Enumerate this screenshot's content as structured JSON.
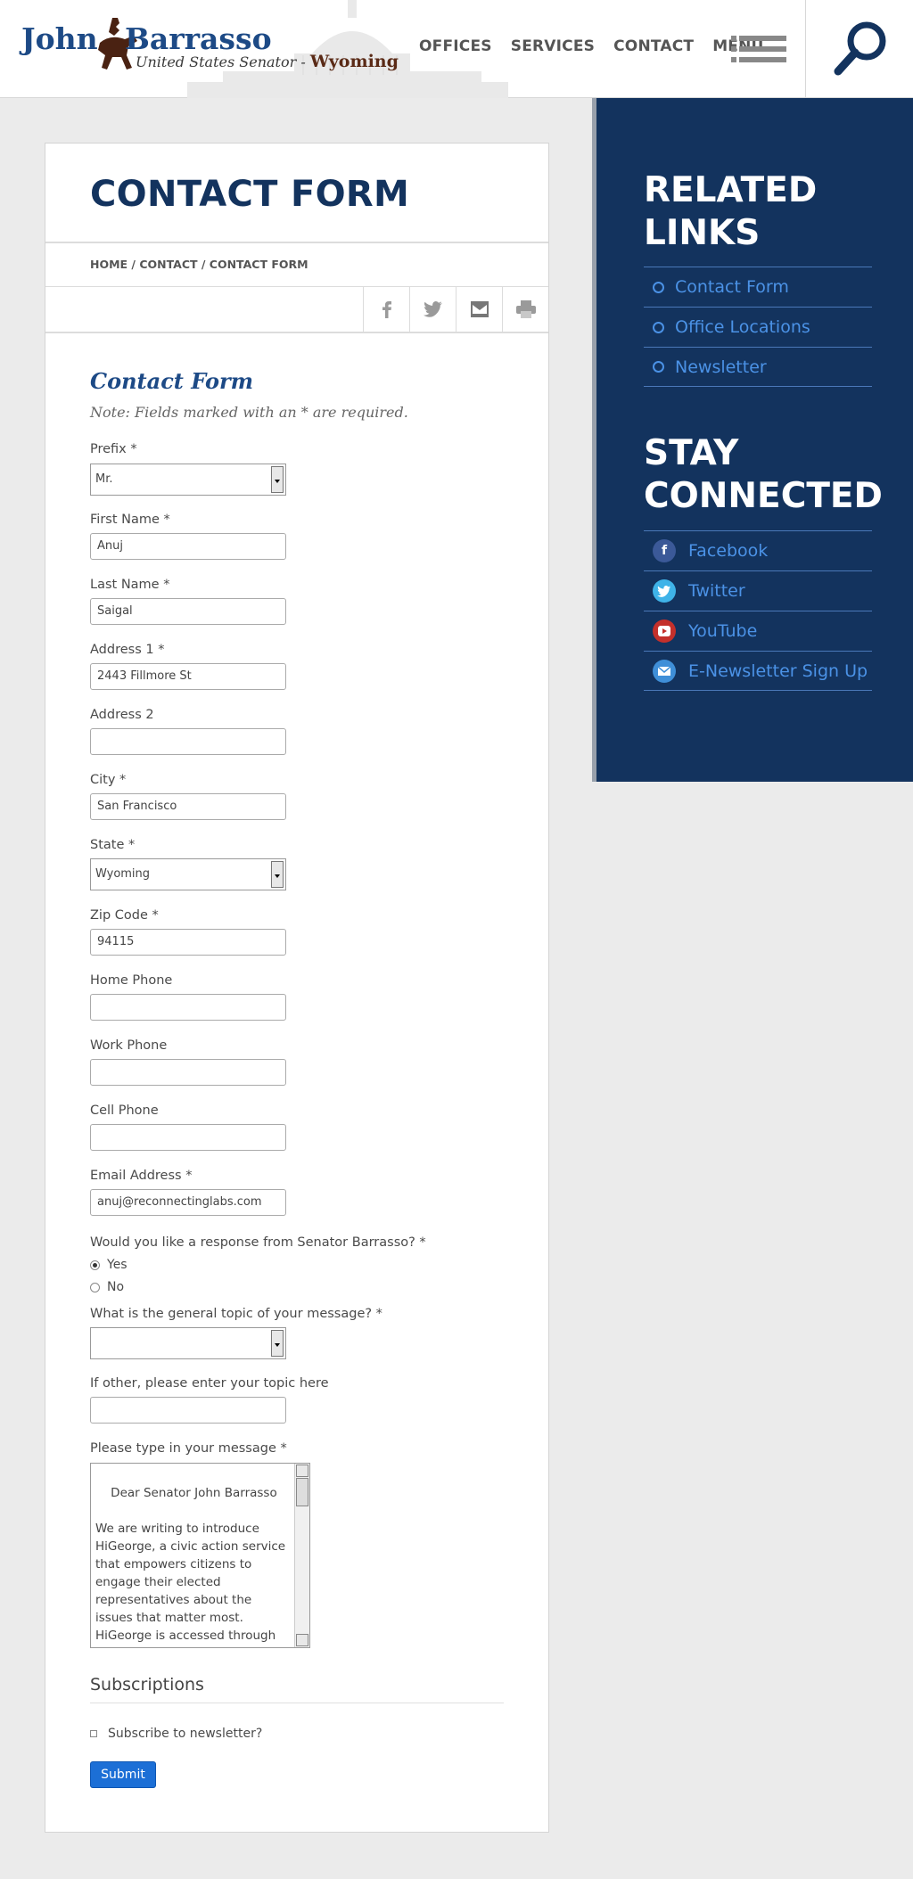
{
  "header": {
    "logo_first": "John",
    "logo_last": "Barrasso",
    "logo_title": "United States Senator - ",
    "logo_state": "Wyoming",
    "nav": [
      "OFFICES",
      "SERVICES",
      "CONTACT",
      "MENU"
    ]
  },
  "page": {
    "title": "CONTACT FORM",
    "breadcrumb": "HOME / CONTACT / CONTACT FORM"
  },
  "form": {
    "title": "Contact Form",
    "note": "Note: Fields marked with an * are required.",
    "prefix": {
      "label": "Prefix *",
      "value": "Mr."
    },
    "first_name": {
      "label": "First Name *",
      "value": "Anuj"
    },
    "last_name": {
      "label": "Last Name *",
      "value": "Saigal"
    },
    "address1": {
      "label": "Address 1 *",
      "value": "2443 Fillmore St"
    },
    "address2": {
      "label": "Address 2",
      "value": ""
    },
    "city": {
      "label": "City *",
      "value": "San Francisco"
    },
    "state": {
      "label": "State *",
      "value": "Wyoming"
    },
    "zip": {
      "label": "Zip Code *",
      "value": "94115"
    },
    "home_phone": {
      "label": "Home Phone",
      "value": ""
    },
    "work_phone": {
      "label": "Work Phone",
      "value": ""
    },
    "cell_phone": {
      "label": "Cell Phone",
      "value": ""
    },
    "email": {
      "label": "Email Address *",
      "value": "anuj@reconnectinglabs.com"
    },
    "response": {
      "label": "Would you like a response from Senator Barrasso? *",
      "yes": "Yes",
      "no": "No"
    },
    "topic": {
      "label": "What is the general topic of your message? *",
      "value": ""
    },
    "other_topic": {
      "label": "If other, please enter your topic here",
      "value": ""
    },
    "message": {
      "label": "Please type in your message *",
      "value": "Dear Senator John Barrasso\n\nWe are writing to introduce HiGeorge, a civic action service that empowers citizens to engage their elected representatives about the issues that matter most. HiGeorge is accessed through citizens' existing social and"
    },
    "subscriptions_title": "Subscriptions",
    "subscribe_label": "Subscribe to newsletter?",
    "submit": "Submit"
  },
  "sidebar": {
    "related_title_1": "RELATED",
    "related_title_2": "LINKS",
    "related": [
      "Contact Form",
      "Office Locations",
      "Newsletter"
    ],
    "stay_title_1": "STAY",
    "stay_title_2": "CONNECTED",
    "social": [
      {
        "label": "Facebook",
        "icon": "facebook-icon",
        "color": "#3b5998"
      },
      {
        "label": "Twitter",
        "icon": "twitter-icon",
        "color": "#3fb3e8"
      },
      {
        "label": "YouTube",
        "icon": "youtube-icon",
        "color": "#c4302b"
      },
      {
        "label": "E-Newsletter Sign Up",
        "icon": "mail-icon",
        "color": "#3f8fd8"
      }
    ]
  },
  "colors": {
    "navy": "#13335e",
    "link_blue": "#4b92e6",
    "submit_blue": "#1c6fd6"
  }
}
